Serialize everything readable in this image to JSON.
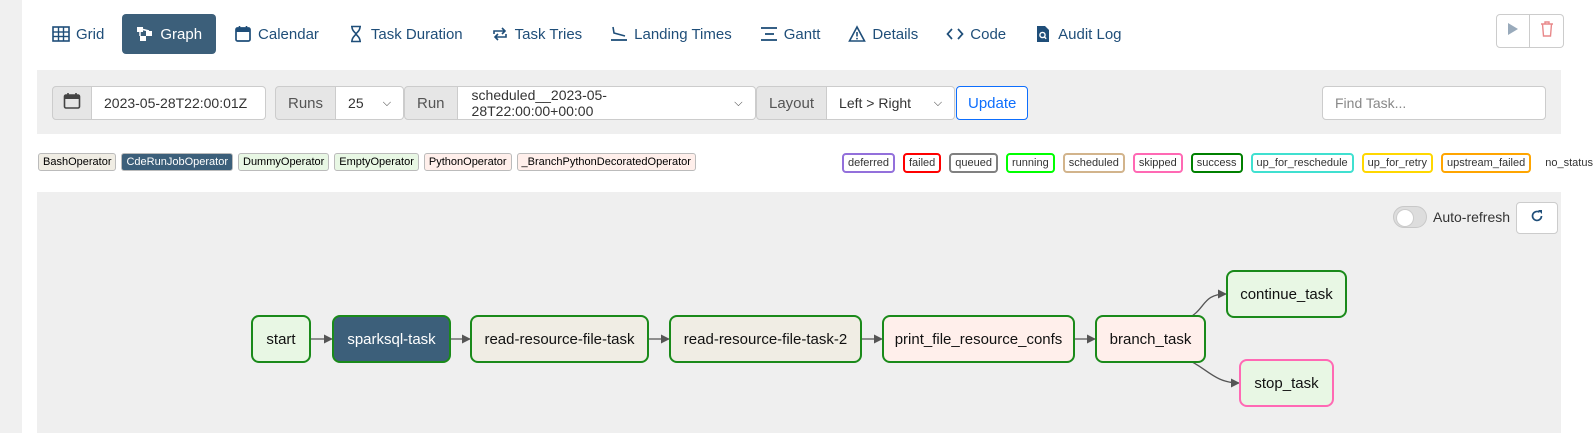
{
  "tabs": [
    {
      "label": "Grid",
      "icon": "grid-icon"
    },
    {
      "label": "Graph",
      "icon": "graph-icon"
    },
    {
      "label": "Calendar",
      "icon": "calendar-icon"
    },
    {
      "label": "Task Duration",
      "icon": "hourglass-icon"
    },
    {
      "label": "Task Tries",
      "icon": "repeat-icon"
    },
    {
      "label": "Landing Times",
      "icon": "landing-icon"
    },
    {
      "label": "Gantt",
      "icon": "gantt-icon"
    },
    {
      "label": "Details",
      "icon": "warning-triangle-icon"
    },
    {
      "label": "Code",
      "icon": "code-icon"
    },
    {
      "label": "Audit Log",
      "icon": "document-search-icon"
    }
  ],
  "active_tab": "Graph",
  "filters": {
    "date_value": "2023-05-28T22:00:01Z",
    "runs_label": "Runs",
    "runs_value": "25",
    "run_label": "Run",
    "run_value": "scheduled__2023-05-28T22:00:00+00:00",
    "layout_label": "Layout",
    "layout_value": "Left > Right",
    "update_label": "Update",
    "find_placeholder": "Find Task..."
  },
  "operators": [
    {
      "label": "BashOperator",
      "bg": "#f0ede4",
      "fg": "#000000"
    },
    {
      "label": "CdeRunJobOperator",
      "bg": "#3c5f7a",
      "fg": "#ffffff"
    },
    {
      "label": "DummyOperator",
      "bg": "#e8f7e4",
      "fg": "#000000"
    },
    {
      "label": "EmptyOperator",
      "bg": "#e8f7e4",
      "fg": "#000000"
    },
    {
      "label": "PythonOperator",
      "bg": "#ffefeb",
      "fg": "#000000"
    },
    {
      "label": "_BranchPythonDecoratedOperator",
      "bg": "#ffefeb",
      "fg": "#000000"
    }
  ],
  "statuses": [
    {
      "label": "deferred",
      "color": "#9370db"
    },
    {
      "label": "failed",
      "color": "#ff0000"
    },
    {
      "label": "queued",
      "color": "#808080"
    },
    {
      "label": "running",
      "color": "#00ff00"
    },
    {
      "label": "scheduled",
      "color": "#d2b48c"
    },
    {
      "label": "skipped",
      "color": "#ff69b4"
    },
    {
      "label": "success",
      "color": "#008000"
    },
    {
      "label": "up_for_reschedule",
      "color": "#40e0d0"
    },
    {
      "label": "up_for_retry",
      "color": "#ffd700"
    },
    {
      "label": "upstream_failed",
      "color": "#ffa500"
    },
    {
      "label": "no_status",
      "color": ""
    }
  ],
  "graph": {
    "auto_refresh_label": "Auto-refresh",
    "auto_refresh_on": false,
    "nodes": [
      {
        "id": "start",
        "label": "start",
        "bg": "#e8f7e4",
        "fg": "#111111",
        "border": "#1a8a1a"
      },
      {
        "id": "sparksql-task",
        "label": "sparksql-task",
        "bg": "#3c5f7a",
        "fg": "#ffffff",
        "border": "#1a8a1a"
      },
      {
        "id": "read-resource-file-task",
        "label": "read-resource-file-task",
        "bg": "#f0ede4",
        "fg": "#111111",
        "border": "#1a8a1a"
      },
      {
        "id": "read-resource-file-task-2",
        "label": "read-resource-file-task-2",
        "bg": "#f0ede4",
        "fg": "#111111",
        "border": "#1a8a1a"
      },
      {
        "id": "print_file_resource_confs",
        "label": "print_file_resource_confs",
        "bg": "#ffefeb",
        "fg": "#111111",
        "border": "#1a8a1a"
      },
      {
        "id": "branch_task",
        "label": "branch_task",
        "bg": "#ffefeb",
        "fg": "#111111",
        "border": "#1a8a1a"
      },
      {
        "id": "continue_task",
        "label": "continue_task",
        "bg": "#e8f7e4",
        "fg": "#111111",
        "border": "#1a8a1a"
      },
      {
        "id": "stop_task",
        "label": "stop_task",
        "bg": "#e8f7e4",
        "fg": "#111111",
        "border": "#ff69b4"
      }
    ],
    "edges": [
      [
        "start",
        "sparksql-task"
      ],
      [
        "sparksql-task",
        "read-resource-file-task"
      ],
      [
        "read-resource-file-task",
        "read-resource-file-task-2"
      ],
      [
        "read-resource-file-task-2",
        "print_file_resource_confs"
      ],
      [
        "print_file_resource_confs",
        "branch_task"
      ],
      [
        "branch_task",
        "continue_task"
      ],
      [
        "branch_task",
        "stop_task"
      ]
    ]
  }
}
